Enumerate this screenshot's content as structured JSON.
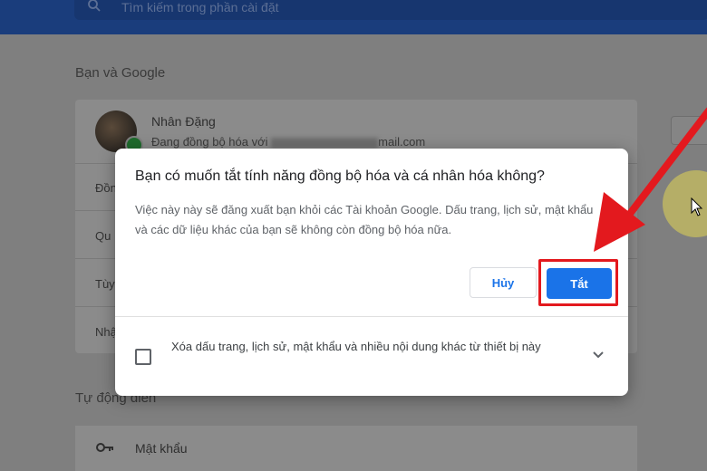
{
  "search": {
    "placeholder": "Tìm kiếm trong phần cài đặt",
    "icon": "search-icon"
  },
  "background": {
    "section_title": "Bạn và Google",
    "account": {
      "name": "Nhân Đặng",
      "sync_prefix": "Đang đồng bộ hóa với",
      "email_suffix": "mail.com"
    },
    "rows": [
      "Đồn",
      "Qu",
      "Tùy",
      "Nhậ"
    ],
    "autofill_title": "Tự động điền",
    "password_label": "Mật khẩu"
  },
  "dialog": {
    "title": "Bạn có muốn tắt tính năng đồng bộ hóa và cá nhân hóa không?",
    "body": "Việc này này sẽ đăng xuất bạn khỏi các Tài khoản Google. Dấu trang, lịch sử, mật khẩu và các dữ liệu khác của bạn sẽ không còn đồng bộ hóa nữa.",
    "cancel_label": "Hủy",
    "confirm_label": "Tắt",
    "checkbox_label": "Xóa dấu trang, lịch sử, mật khẩu và nhiều nội dung khác từ thiết bị này",
    "checkbox_checked": false
  },
  "colors": {
    "primary": "#1a73e8",
    "annotation": "#e3191e",
    "topbar": "#1a3d7c"
  }
}
